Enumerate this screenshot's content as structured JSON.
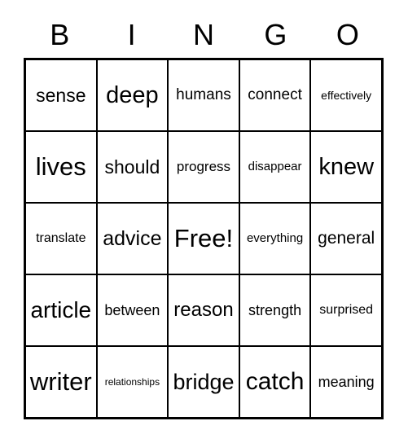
{
  "card": {
    "title": "BINGO",
    "free_space_label": "Free!",
    "colors": {
      "background": "#ffffff",
      "border": "#000000",
      "text": "#000000"
    },
    "header": {
      "letters": [
        "B",
        "I",
        "N",
        "G",
        "O"
      ]
    },
    "grid": {
      "columns": 5,
      "rows": 5,
      "cells": [
        [
          {
            "label": "sense",
            "font_size": 23
          },
          {
            "label": "deep",
            "font_size": 29
          },
          {
            "label": "humans",
            "font_size": 19
          },
          {
            "label": "connect",
            "font_size": 19
          },
          {
            "label": "effectively",
            "font_size": 14
          }
        ],
        [
          {
            "label": "lives",
            "font_size": 31
          },
          {
            "label": "should",
            "font_size": 23
          },
          {
            "label": "progress",
            "font_size": 17
          },
          {
            "label": "disappear",
            "font_size": 15
          },
          {
            "label": "knew",
            "font_size": 29
          }
        ],
        [
          {
            "label": "translate",
            "font_size": 16
          },
          {
            "label": "advice",
            "font_size": 25
          },
          {
            "label": "Free!",
            "font_size": 31
          },
          {
            "label": "everything",
            "font_size": 15
          },
          {
            "label": "general",
            "font_size": 21
          }
        ],
        [
          {
            "label": "article",
            "font_size": 28
          },
          {
            "label": "between",
            "font_size": 18
          },
          {
            "label": "reason",
            "font_size": 24
          },
          {
            "label": "strength",
            "font_size": 18
          },
          {
            "label": "surprised",
            "font_size": 16
          }
        ],
        [
          {
            "label": "writer",
            "font_size": 31
          },
          {
            "label": "relationships",
            "font_size": 12
          },
          {
            "label": "bridge",
            "font_size": 27
          },
          {
            "label": "catch",
            "font_size": 30
          },
          {
            "label": "meaning",
            "font_size": 18
          }
        ]
      ]
    }
  }
}
